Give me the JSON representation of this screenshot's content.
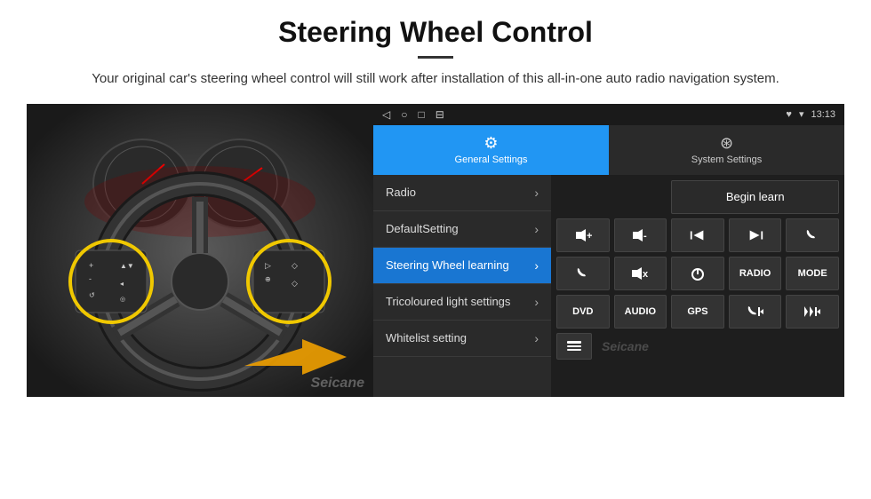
{
  "page": {
    "title": "Steering Wheel Control",
    "subtitle": "Your original car's steering wheel control will still work after installation of this all-in-one auto radio navigation system."
  },
  "status_bar": {
    "time": "13:13",
    "icons_left": [
      "◁",
      "○",
      "□",
      "⊟"
    ],
    "icons_right": [
      "♥",
      "▾"
    ]
  },
  "tabs": {
    "general": {
      "label": "General Settings",
      "icon": "⚙"
    },
    "system": {
      "label": "System Settings",
      "icon": "⊛"
    }
  },
  "menu_items": [
    {
      "label": "Radio",
      "active": false
    },
    {
      "label": "DefaultSetting",
      "active": false
    },
    {
      "label": "Steering Wheel learning",
      "active": true
    },
    {
      "label": "Tricoloured light settings",
      "active": false
    },
    {
      "label": "Whitelist setting",
      "active": false
    }
  ],
  "right_panel": {
    "begin_learn": "Begin learn",
    "button_rows": [
      [
        "🔊+",
        "🔊-",
        "⏮",
        "⏭",
        "📞"
      ],
      [
        "📞",
        "🔇x",
        "⏻",
        "RADIO",
        "MODE"
      ],
      [
        "DVD",
        "AUDIO",
        "GPS",
        "📞⏮",
        "⏮⏭"
      ]
    ]
  }
}
